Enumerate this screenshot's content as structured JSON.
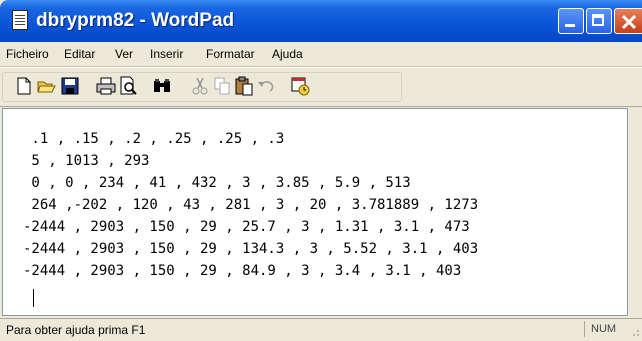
{
  "window": {
    "title": "dbryprm82 - WordPad",
    "app_icon": "wordpad-document-icon",
    "controls": [
      "minimize-icon",
      "maximize-icon",
      "close-icon"
    ]
  },
  "menu": {
    "items": [
      {
        "label": "Ficheiro"
      },
      {
        "label": "Editar"
      },
      {
        "label": "Ver"
      },
      {
        "label": "Inserir"
      },
      {
        "label": "Formatar"
      },
      {
        "label": "Ajuda"
      }
    ]
  },
  "toolbar": {
    "buttons": [
      "new-document-icon",
      "open-folder-icon",
      "save-icon",
      "print-icon",
      "print-preview-icon",
      "find-icon",
      "cut-icon",
      "copy-icon",
      "paste-icon",
      "undo-icon",
      "insert-date-time-icon"
    ]
  },
  "document": {
    "lines": [
      " .1 , .15 , .2 , .25 , .25 , .3",
      " 5 , 1013 , 293",
      " 0 , 0 , 234 , 41 , 432 , 3 , 3.85 , 5.9 , 513",
      " 264 ,-202 , 120 , 43 , 281 , 3 , 20 , 3.781889 , 1273",
      "-2444 , 2903 , 150 , 29 , 25.7 , 3 , 1.31 , 3.1 , 473",
      "-2444 , 2903 , 150 , 29 , 134.3 , 3 , 5.52 , 3.1 , 403",
      "-2444 , 2903 , 150 , 29 , 84.9 , 3 , 3.4 , 3.1 , 403"
    ]
  },
  "status": {
    "help_text": "Para obter ajuda prima F1",
    "num_indicator": "NUM"
  },
  "colors": {
    "titlebar": "#0a56d8",
    "close_button": "#c2401a",
    "chrome": "#ece9d8"
  }
}
